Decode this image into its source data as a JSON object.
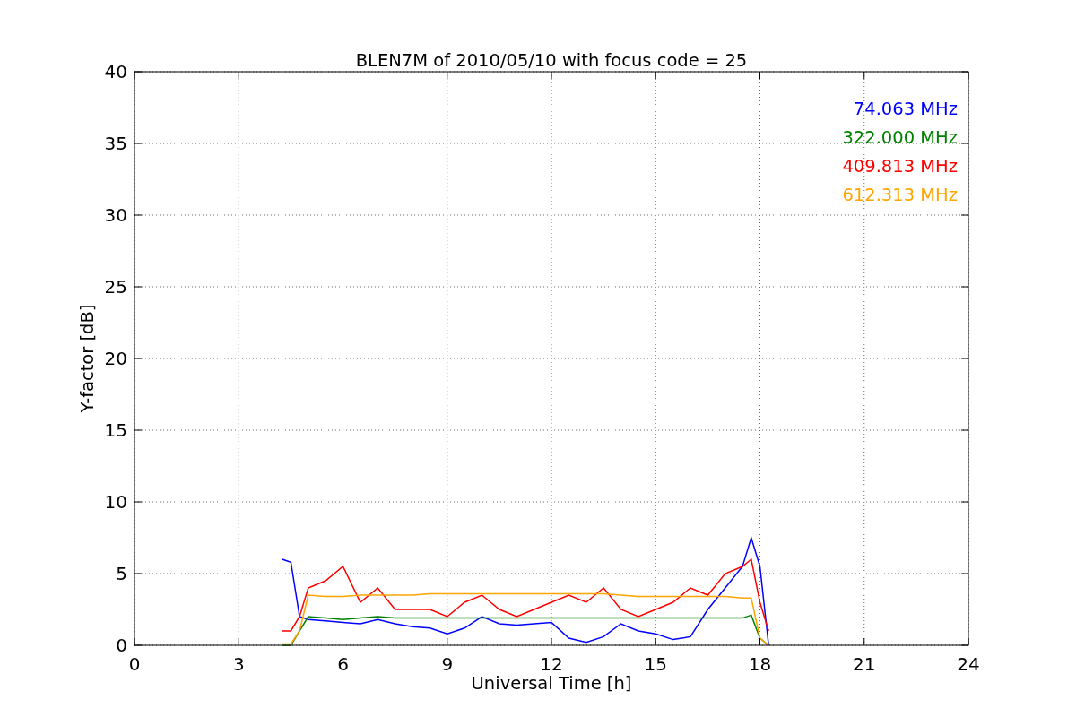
{
  "chart_data": {
    "type": "line",
    "title": "BLEN7M of 2010/05/10 with focus code = 25",
    "xlabel": "Universal Time [h]",
    "ylabel": "Y-factor [dB]",
    "x": [
      4.25,
      4.5,
      4.75,
      5,
      5.5,
      6,
      6.5,
      7,
      7.5,
      8,
      8.5,
      9,
      9.5,
      10,
      10.5,
      11,
      11.5,
      12,
      12.5,
      13,
      13.5,
      14,
      14.5,
      15,
      15.5,
      16,
      16.5,
      17,
      17.5,
      17.75,
      18,
      18.25
    ],
    "series": [
      {
        "name": "74.063 MHz",
        "color": "#0000ff",
        "values": [
          6,
          5.8,
          2,
          1.8,
          1.7,
          1.6,
          1.5,
          1.8,
          1.5,
          1.3,
          1.2,
          0.8,
          1.2,
          2,
          1.5,
          1.4,
          1.5,
          1.6,
          0.5,
          0.2,
          0.6,
          1.5,
          1,
          0.8,
          0.4,
          0.6,
          2.5,
          4,
          5.5,
          7.5,
          5.5,
          0
        ]
      },
      {
        "name": "322.000 MHz",
        "color": "#008000",
        "values": [
          0,
          0,
          1,
          2,
          1.9,
          1.8,
          1.9,
          2,
          1.9,
          1.9,
          1.9,
          1.9,
          1.9,
          1.9,
          1.9,
          1.9,
          1.9,
          1.9,
          1.9,
          1.9,
          1.9,
          1.9,
          1.9,
          1.9,
          1.9,
          1.9,
          1.9,
          1.9,
          1.9,
          2.1,
          0.5,
          0
        ]
      },
      {
        "name": "409.813 MHz",
        "color": "#ff0000",
        "values": [
          1,
          1,
          2,
          4,
          4.5,
          5.5,
          3,
          4,
          2.5,
          2.5,
          2.5,
          2,
          3,
          3.5,
          2.5,
          2,
          2.5,
          3,
          3.5,
          3,
          4,
          2.5,
          2,
          2.5,
          3,
          4,
          3.5,
          5,
          5.5,
          6,
          3,
          1
        ]
      },
      {
        "name": "612.313 MHz",
        "color": "#ffa500",
        "values": [
          0.1,
          0.1,
          1,
          3.5,
          3.4,
          3.4,
          3.5,
          3.5,
          3.5,
          3.5,
          3.6,
          3.6,
          3.6,
          3.6,
          3.6,
          3.6,
          3.6,
          3.6,
          3.6,
          3.6,
          3.6,
          3.5,
          3.4,
          3.4,
          3.4,
          3.4,
          3.4,
          3.4,
          3.3,
          3.3,
          0.5,
          0
        ]
      }
    ],
    "xlim": [
      0,
      24
    ],
    "ylim": [
      0,
      40
    ],
    "xticks": [
      0,
      3,
      6,
      9,
      12,
      15,
      18,
      21,
      24
    ],
    "yticks": [
      0,
      5,
      10,
      15,
      20,
      25,
      30,
      35,
      40
    ],
    "grid": true
  }
}
